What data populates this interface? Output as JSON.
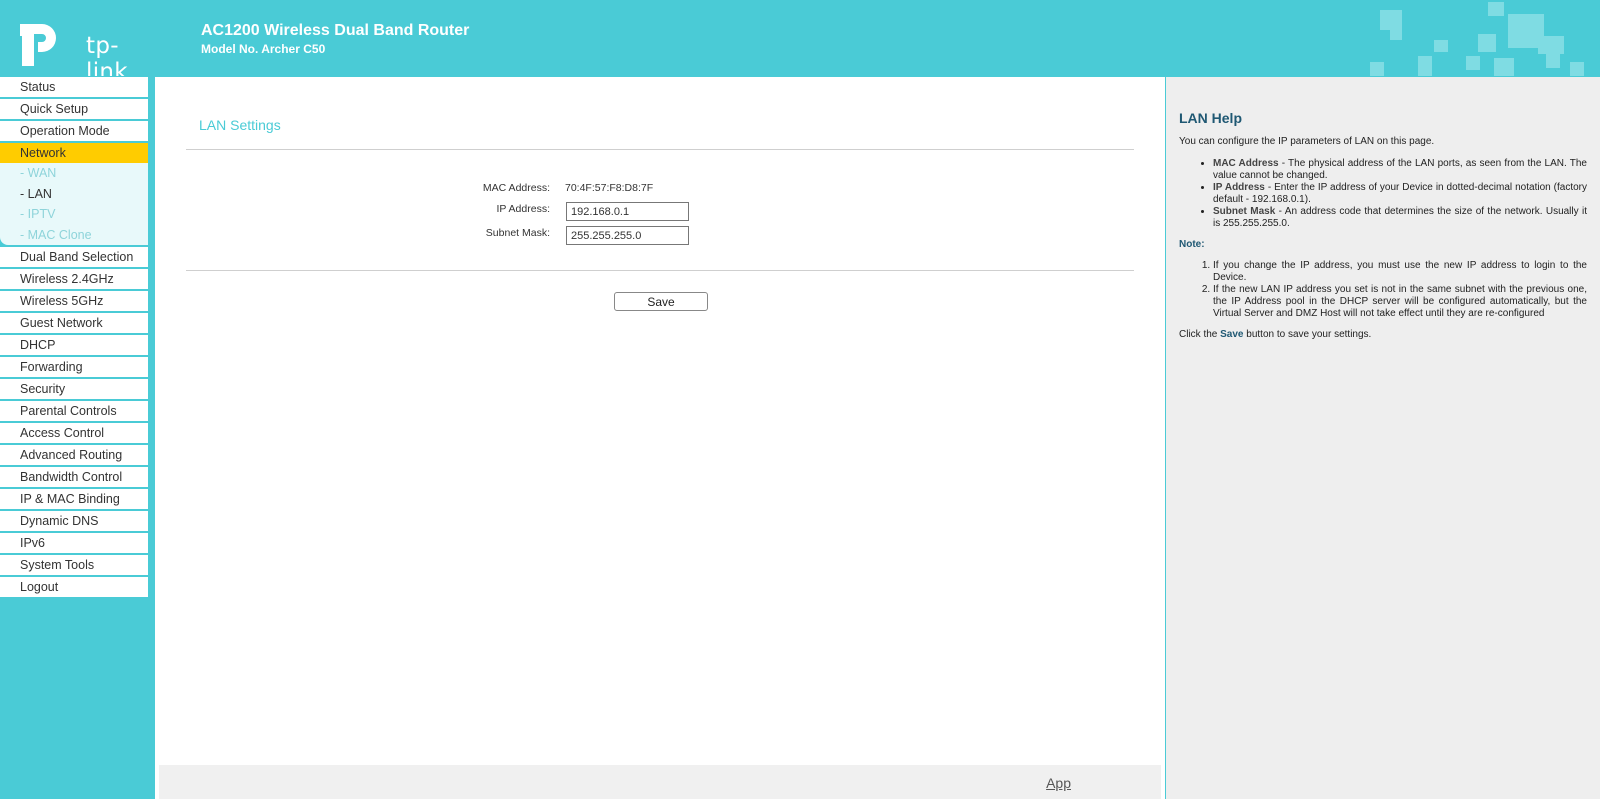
{
  "header": {
    "brand": "tp-link",
    "title": "AC1200 Wireless Dual Band Router",
    "model": "Model No. Archer C50"
  },
  "sidebar": {
    "items": [
      {
        "label": "Status"
      },
      {
        "label": "Quick Setup"
      },
      {
        "label": "Operation Mode"
      },
      {
        "label": "Network"
      },
      {
        "label": "Dual Band Selection"
      },
      {
        "label": "Wireless 2.4GHz"
      },
      {
        "label": "Wireless 5GHz"
      },
      {
        "label": "Guest Network"
      },
      {
        "label": "DHCP"
      },
      {
        "label": "Forwarding"
      },
      {
        "label": "Security"
      },
      {
        "label": "Parental Controls"
      },
      {
        "label": "Access Control"
      },
      {
        "label": "Advanced Routing"
      },
      {
        "label": "Bandwidth Control"
      },
      {
        "label": "IP & MAC Binding"
      },
      {
        "label": "Dynamic DNS"
      },
      {
        "label": "IPv6"
      },
      {
        "label": "System Tools"
      },
      {
        "label": "Logout"
      }
    ],
    "network_sub": [
      {
        "label": "- WAN"
      },
      {
        "label": "- LAN"
      },
      {
        "label": "- IPTV"
      },
      {
        "label": "- MAC Clone"
      }
    ]
  },
  "main": {
    "section_title": "LAN Settings",
    "mac_label": "MAC Address:",
    "mac_value": "70:4F:57:F8:D8:7F",
    "ip_label": "IP Address:",
    "ip_value": "192.168.0.1",
    "mask_label": "Subnet Mask:",
    "mask_value": "255.255.255.0",
    "save_label": "Save",
    "app_link": "App"
  },
  "help": {
    "title": "LAN Help",
    "intro": "You can configure the IP parameters of LAN on this page.",
    "items": [
      {
        "term": "MAC Address",
        "text": " - The physical address of the LAN ports, as seen from the LAN. The value cannot be changed."
      },
      {
        "term": "IP Address",
        "text": " - Enter the IP address of your Device in dotted-decimal notation (factory default - 192.168.0.1)."
      },
      {
        "term": "Subnet Mask",
        "text": " - An address code that determines the size of the network. Usually it is 255.255.255.0."
      }
    ],
    "note_title": "Note:",
    "notes": [
      "If you change the IP address, you must use the new IP address to login to the Device.",
      "If the new LAN IP address you set is not in the same subnet with the previous one, the IP Address pool in the DHCP server will be configured automatically, but the Virtual Server and DMZ Host will not take effect until they are re-configured"
    ],
    "footer_pre": "Click the ",
    "footer_save": "Save",
    "footer_post": " button to save your settings."
  },
  "colors": {
    "accent": "#4ACBD6",
    "active_menu": "#FFCC00",
    "help_heading": "#1F5873"
  }
}
